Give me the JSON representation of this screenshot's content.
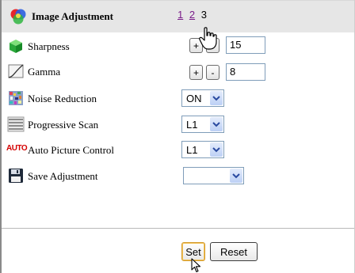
{
  "header": {
    "title": "Image Adjustment",
    "pages": [
      "1",
      "2"
    ],
    "current_page": "3",
    "icon": "color-wheel-icon"
  },
  "rows": [
    {
      "label": "Sharpness",
      "icon": "green-cube-icon",
      "plus": "+",
      "minus": "-",
      "value": "15"
    },
    {
      "label": "Gamma",
      "icon": "gamma-curve-icon",
      "plus": "+",
      "minus": "-",
      "value": "8"
    },
    {
      "label": "Noise Reduction",
      "icon": "noise-pattern-icon",
      "value": "ON"
    },
    {
      "label": "Progressive Scan",
      "icon": "scan-lines-icon",
      "value": "L1"
    },
    {
      "label": "Auto Picture Control",
      "icon": "auto-badge-icon",
      "icon_text": "AUTO",
      "value": "L1"
    },
    {
      "label": "Save Adjustment",
      "icon": "floppy-disk-icon",
      "value": ""
    }
  ],
  "actions": {
    "set": "Set",
    "reset": "Reset"
  },
  "colors": {
    "header_bg": "#e6e6e6",
    "link": "#7a1c8a",
    "input_border": "#7f9db9",
    "auto_red": "#d40000"
  }
}
